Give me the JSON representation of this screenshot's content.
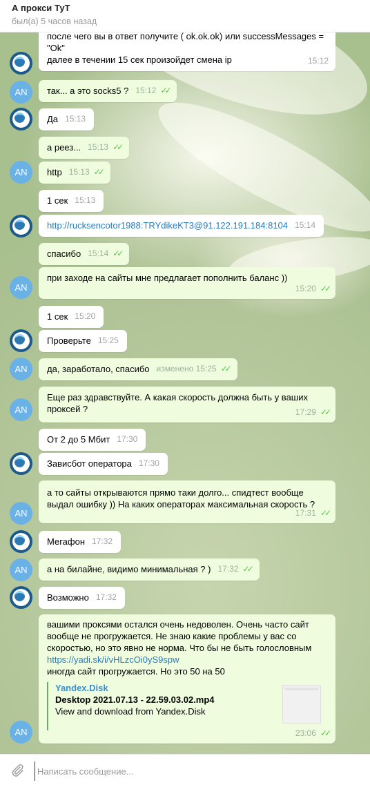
{
  "header": {
    "title": "А прокси ТуТ",
    "status": "был(а) 5 часов назад"
  },
  "avatars": {
    "user_initials": "AN",
    "bot_icon": "proxy-logo-icon"
  },
  "colors": {
    "outgoing_bubble": "#effdde",
    "incoming_bubble": "#ffffff",
    "tick": "#5dc452",
    "avatar_user": "#6ab1e6",
    "link": "#2a7abf"
  },
  "messages": [
    {
      "text": "после чего вы в ответ получите ( ok.ok.ok) или successMessages = \"Ok\"",
      "text2": "далее в течении 15 сек произойдет смена ip",
      "time": "15:12"
    },
    {
      "text": "так... а это socks5 ?",
      "time": "15:12"
    },
    {
      "text": "Да",
      "time": "15:13"
    },
    {
      "text": "а реез...",
      "time": "15:13"
    },
    {
      "text": "http",
      "time": "15:13"
    },
    {
      "text": "1 сек",
      "time": "15:13"
    },
    {
      "text": "http://rucksencotor1988:TRYdikeKT3@91.122.191.184:8104",
      "time": "15:14"
    },
    {
      "text": "спасибо",
      "time": "15:14"
    },
    {
      "text": "при заходе на сайты мне предлагает пополнить баланс ))",
      "time": "15:20"
    },
    {
      "text": "1 сек",
      "time": "15:20"
    },
    {
      "text": "Проверьте",
      "time": "15:25"
    },
    {
      "text": "да, заработало, спасибо",
      "time": "изменено 15:25"
    },
    {
      "text": "Еще раз здравствуйте. А какая скорость должна быть у ваших",
      "text2": "проксей ?",
      "time": "17:29"
    },
    {
      "text": "От 2 до 5 Мбит",
      "time": "17:30"
    },
    {
      "text": "Зависбот оператора",
      "time": "17:30"
    },
    {
      "text": "а то сайты открываются прямо таки долго... спидтест вообще",
      "text2": "выдал ошибку )) На каких операторах максимальная скорость ?",
      "time": "17:31"
    },
    {
      "text": "Мегафон",
      "time": "17:32"
    },
    {
      "text": "а на билайне, видимо минимальная ? )",
      "time": "17:32"
    },
    {
      "text": "Возможно",
      "time": "17:32"
    },
    {
      "lines": [
        "вашими проксями остался очень недоволен. Очень часто сайт",
        "вообще не прогружается. Не знаю какие проблемы у вас со",
        "скоростью, но это явно не норма. Что бы не быть голословным"
      ],
      "link": "https://yadi.sk/i/vHLzcOi0yS9spw",
      "after": "иногда сайт прогружается. Но это 50 на 50",
      "preview": {
        "site": "Yandex.Disk",
        "title": "Desktop 2021.07.13 - 22.59.03.02.mp4",
        "desc": "View and download from Yandex.Disk"
      },
      "time": "23:06"
    }
  ],
  "composer": {
    "placeholder": "Написать сообщение...",
    "attach_icon": "paperclip-icon"
  }
}
